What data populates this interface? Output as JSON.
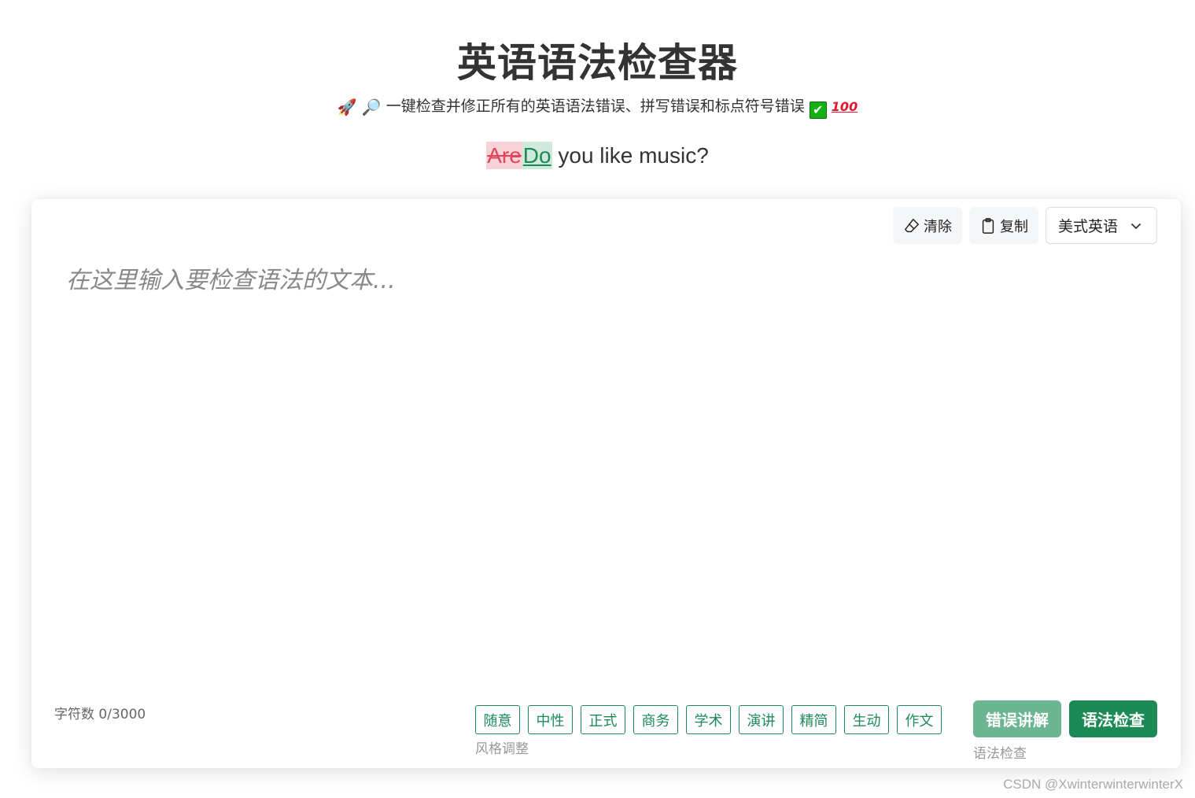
{
  "header": {
    "title": "英语语法检查器",
    "subtitle_rocket": "🚀",
    "subtitle_magnifier": "🔎",
    "subtitle_text": "一键检查并修正所有的英语语法错误、拼写错误和标点符号错误",
    "subtitle_check": "✔",
    "subtitle_hundred": "100"
  },
  "example": {
    "wrong_word": "Are",
    "correct_word": "Do",
    "rest": " you like music?"
  },
  "toolbar": {
    "clear_label": "清除",
    "copy_label": "复制",
    "language_selected": "美式英语"
  },
  "editor": {
    "placeholder": "在这里输入要检查语法的文本...",
    "value": ""
  },
  "footer": {
    "char_count": "字符数 0/3000",
    "styles": [
      "随意",
      "中性",
      "正式",
      "商务",
      "学术",
      "演讲",
      "精简",
      "生动",
      "作文"
    ],
    "styles_label": "风格调整",
    "explain_label": "错误讲解",
    "check_label": "语法检查",
    "check_caption": "语法检查"
  },
  "watermark": "CSDN @XwinterwinterwinterX",
  "colors": {
    "accent": "#1b8a54",
    "accent_light": "#6bb592",
    "error_bg": "#f7d3d8",
    "correct_bg": "#cfe9dc"
  }
}
